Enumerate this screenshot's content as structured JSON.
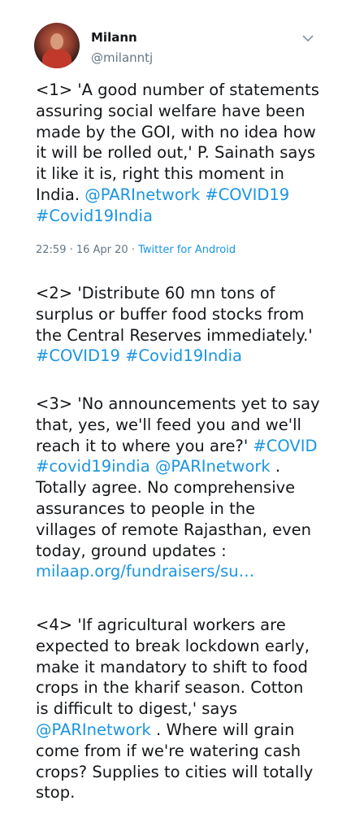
{
  "author": {
    "name": "Milann",
    "handle": "@milanntj"
  },
  "tweets": [
    {
      "segments": [
        {
          "text": "<1> 'A good number of statements assuring social welfare have been made by the GOI, with no idea how it will be rolled out,' P. Sainath says it like it is, right this moment in India. "
        },
        {
          "text": "@PARInetwork",
          "link": true
        },
        {
          "text": " "
        },
        {
          "text": "#COVID19",
          "link": true
        },
        {
          "text": " "
        },
        {
          "text": "#Covid19India",
          "link": true
        }
      ]
    },
    {
      "segments": [
        {
          "text": "<2> 'Distribute 60 mn tons of surplus or buffer food stocks from the Central Reserves immediately.' "
        },
        {
          "text": "#COVID19",
          "link": true
        },
        {
          "text": " "
        },
        {
          "text": "#Covid19India",
          "link": true
        }
      ]
    },
    {
      "segments": [
        {
          "text": "<3> 'No announcements yet to say that, yes, we'll feed you and we'll reach it to where you are?' "
        },
        {
          "text": "#COVID",
          "link": true
        },
        {
          "text": " "
        },
        {
          "text": "#covid19india",
          "link": true
        },
        {
          "text": " "
        },
        {
          "text": "@PARInetwork",
          "link": true
        },
        {
          "text": " . Totally agree. No comprehensive assurances to people in the villages of remote Rajasthan, even today, ground updates : "
        },
        {
          "text": "milaap.org/fundraisers/su…",
          "link": true
        }
      ]
    },
    {
      "segments": [
        {
          "text": "<4> 'If agricultural workers are expected to break lockdown early, make it mandatory to shift to food crops in the kharif season. Cotton is difficult to digest,' says "
        },
        {
          "text": "@PARInetwork",
          "link": true
        },
        {
          "text": " . Where will grain come from if we're watering cash crops? Supplies to cities will totally stop."
        }
      ]
    }
  ],
  "meta": {
    "timestamp": "22:59 · 16 Apr 20 · ",
    "source": "Twitter for Android"
  },
  "icons": {
    "menu": "chevron-down-icon"
  },
  "colors": {
    "link": "#1b95e0",
    "secondary_text": "#657786"
  }
}
